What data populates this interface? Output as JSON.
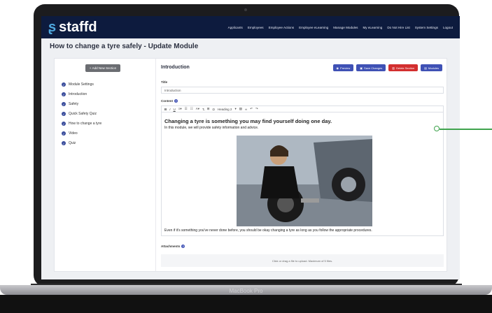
{
  "device": {
    "label": "MacBook Pro"
  },
  "app": {
    "logo_text": "staffd",
    "nav": [
      "Applicants",
      "Employees",
      "Employee Actions",
      "Employee eLearning",
      "Manage Modules",
      "My eLearning",
      "Do Not Hire List",
      "System Settings",
      "Logout"
    ]
  },
  "page": {
    "title": "How to change a tyre safely - Update Module"
  },
  "sidebar": {
    "add_button": "Add New Section",
    "items": [
      "Module Settings",
      "Introduction",
      "Safety",
      "Quick Safety Quiz",
      "How to change a tyre",
      "Video",
      "Quiz"
    ]
  },
  "section": {
    "title": "Introduction",
    "buttons": {
      "preview": "Preview",
      "save": "Save Changes",
      "delete": "Delete Section",
      "modules": "Modules"
    },
    "title_label": "Title",
    "title_value": "Introduction",
    "content_label": "Content",
    "toolbar_heading": "Heading 2",
    "heading": "Changing a tyre is something you may find yourself doing one day.",
    "intro": "In this module, we will provide safety information and advice.",
    "closing": "Even if it's something you've never done before, you should be okay changing a tyre as long as you follow the appropriate procedures.",
    "attachments_label": "Attachments",
    "dropzone_text": "Click or drag a file to upload. Maximum of 5 files."
  },
  "colors": {
    "nav_bg": "#0d1b3e",
    "accent": "#3f51b5",
    "danger": "#d32f2f",
    "callout": "#3fa34d"
  }
}
